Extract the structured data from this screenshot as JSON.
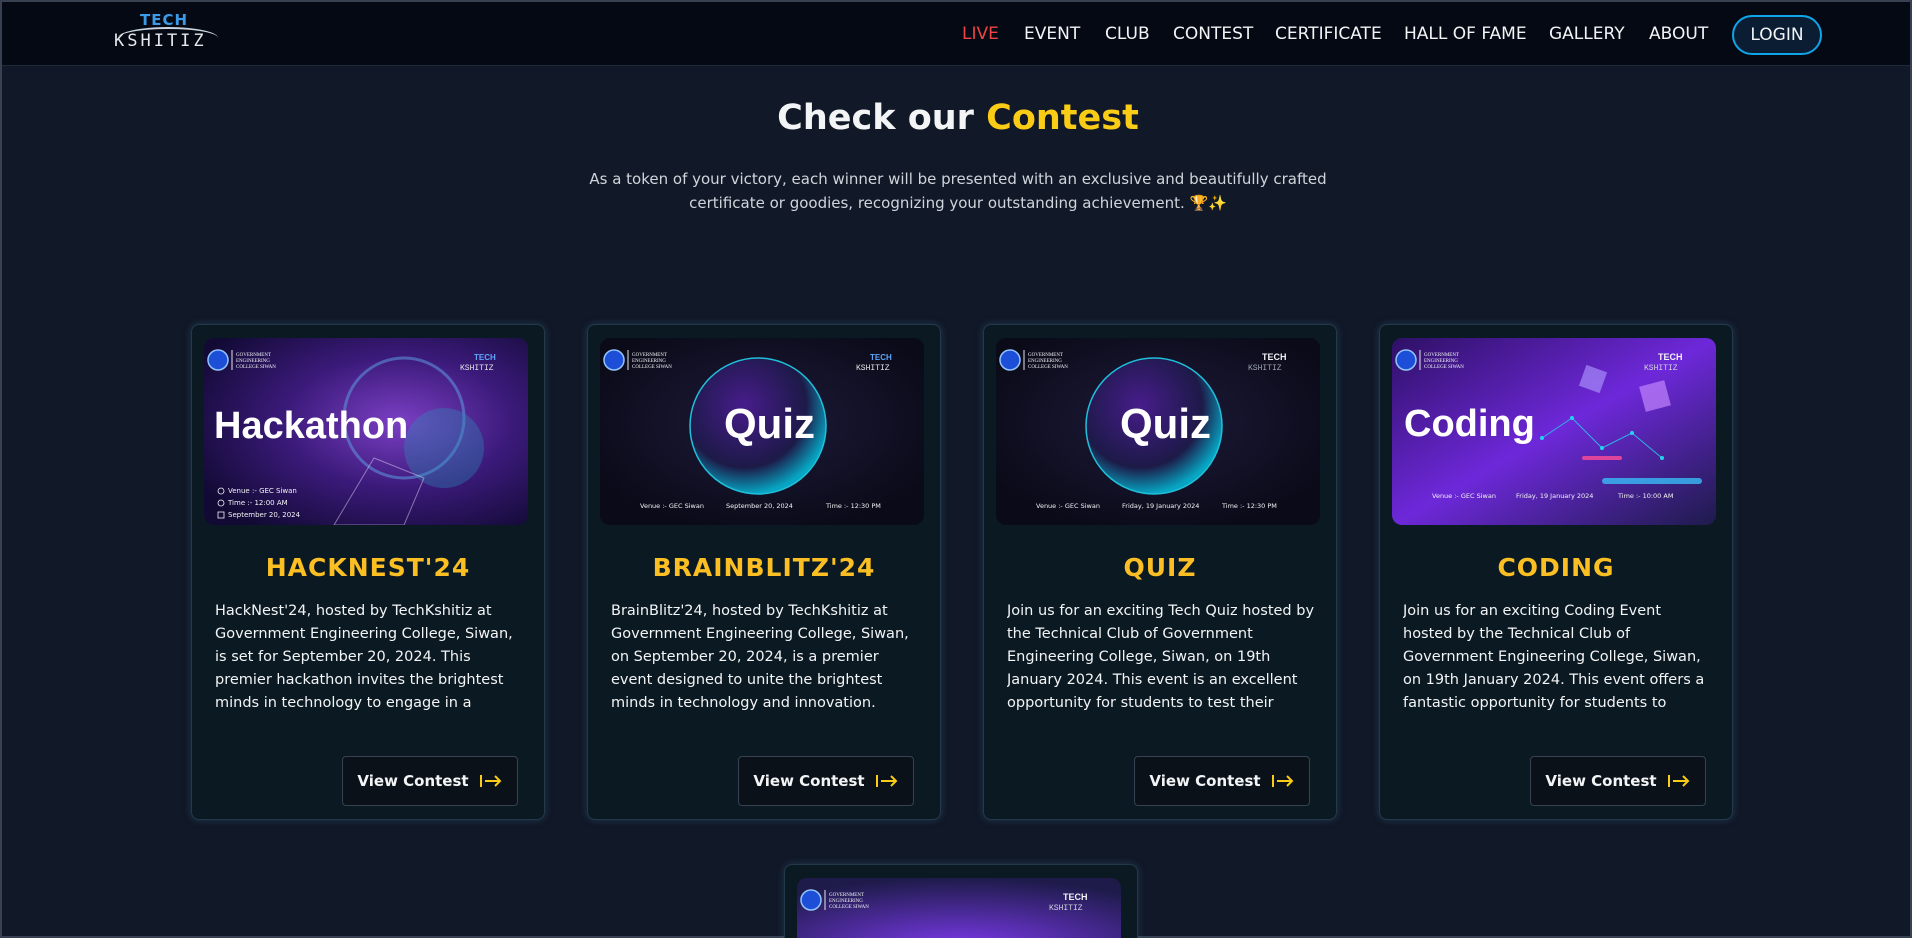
{
  "nav": {
    "logo_top": "TECH",
    "logo_bottom": "KSHITIZ",
    "items": [
      {
        "label": "LIVE"
      },
      {
        "label": "EVENT"
      },
      {
        "label": "CLUB"
      },
      {
        "label": "CONTEST"
      },
      {
        "label": "CERTIFICATE"
      },
      {
        "label": "HALL OF FAME"
      },
      {
        "label": "GALLERY"
      },
      {
        "label": "ABOUT"
      }
    ],
    "login_label": "LOGIN"
  },
  "hero": {
    "title_prefix": "Check our",
    "title_accent": "Contest",
    "subtitle": "As a token of your victory, each winner will be presented with an exclusive and beautifully crafted certificate or goodies, recognizing your outstanding achievement. 🏆✨"
  },
  "cards": [
    {
      "image_word": "Hackathon",
      "image_venue": "Venue :- GEC Siwan",
      "image_time": "Time :- 12:00 AM",
      "image_date": "September 20, 2024",
      "title": "HACKNEST'24",
      "description": "HackNest'24, hosted by TechKshitiz at Government Engineering College, Siwan, is set for September 20, 2024. This premier hackathon invites the brightest minds in technology to engage in a dynamic",
      "button_label": "View Contest"
    },
    {
      "image_word": "Quiz",
      "image_venue": "Venue :- GEC Siwan",
      "image_time": "Time :- 12:30 PM",
      "image_date": "September 20, 2024",
      "title": "BRAINBLITZ'24",
      "description": "BrainBlitz'24, hosted by TechKshitiz at Government Engineering College, Siwan, on September 20, 2024, is a premier event designed to unite the brightest minds in technology and innovation. Participants will",
      "button_label": "View Contest"
    },
    {
      "image_word": "Quiz",
      "image_venue": "Venue :- GEC Siwan",
      "image_time": "Time :- 12:30 PM",
      "image_date": "Friday, 19 January 2024",
      "title": "QUIZ",
      "description": "Join us for an exciting Tech Quiz hosted by the Technical Club of Government Engineering College, Siwan, on 19th January 2024. This event is an excellent opportunity for students to test their knowledge,",
      "button_label": "View Contest"
    },
    {
      "image_word": "Coding",
      "image_venue": "Venue :- GEC Siwan",
      "image_time": "Time :- 10:00 AM",
      "image_date": "Friday, 19 January 2024",
      "title": "CODING",
      "description": "Join us for an exciting Coding Event hosted by the Technical Club of Government Engineering College, Siwan, on 19th January 2024. This event offers a fantastic opportunity for students to showcase their",
      "button_label": "View Contest"
    }
  ],
  "college_badge": "GOVERNMENT ENGINEERING COLLEGE SIWAN",
  "colors": {
    "accent_yellow": "#facc15",
    "live_red": "#ef4444",
    "login_border": "#0ea5e9"
  }
}
